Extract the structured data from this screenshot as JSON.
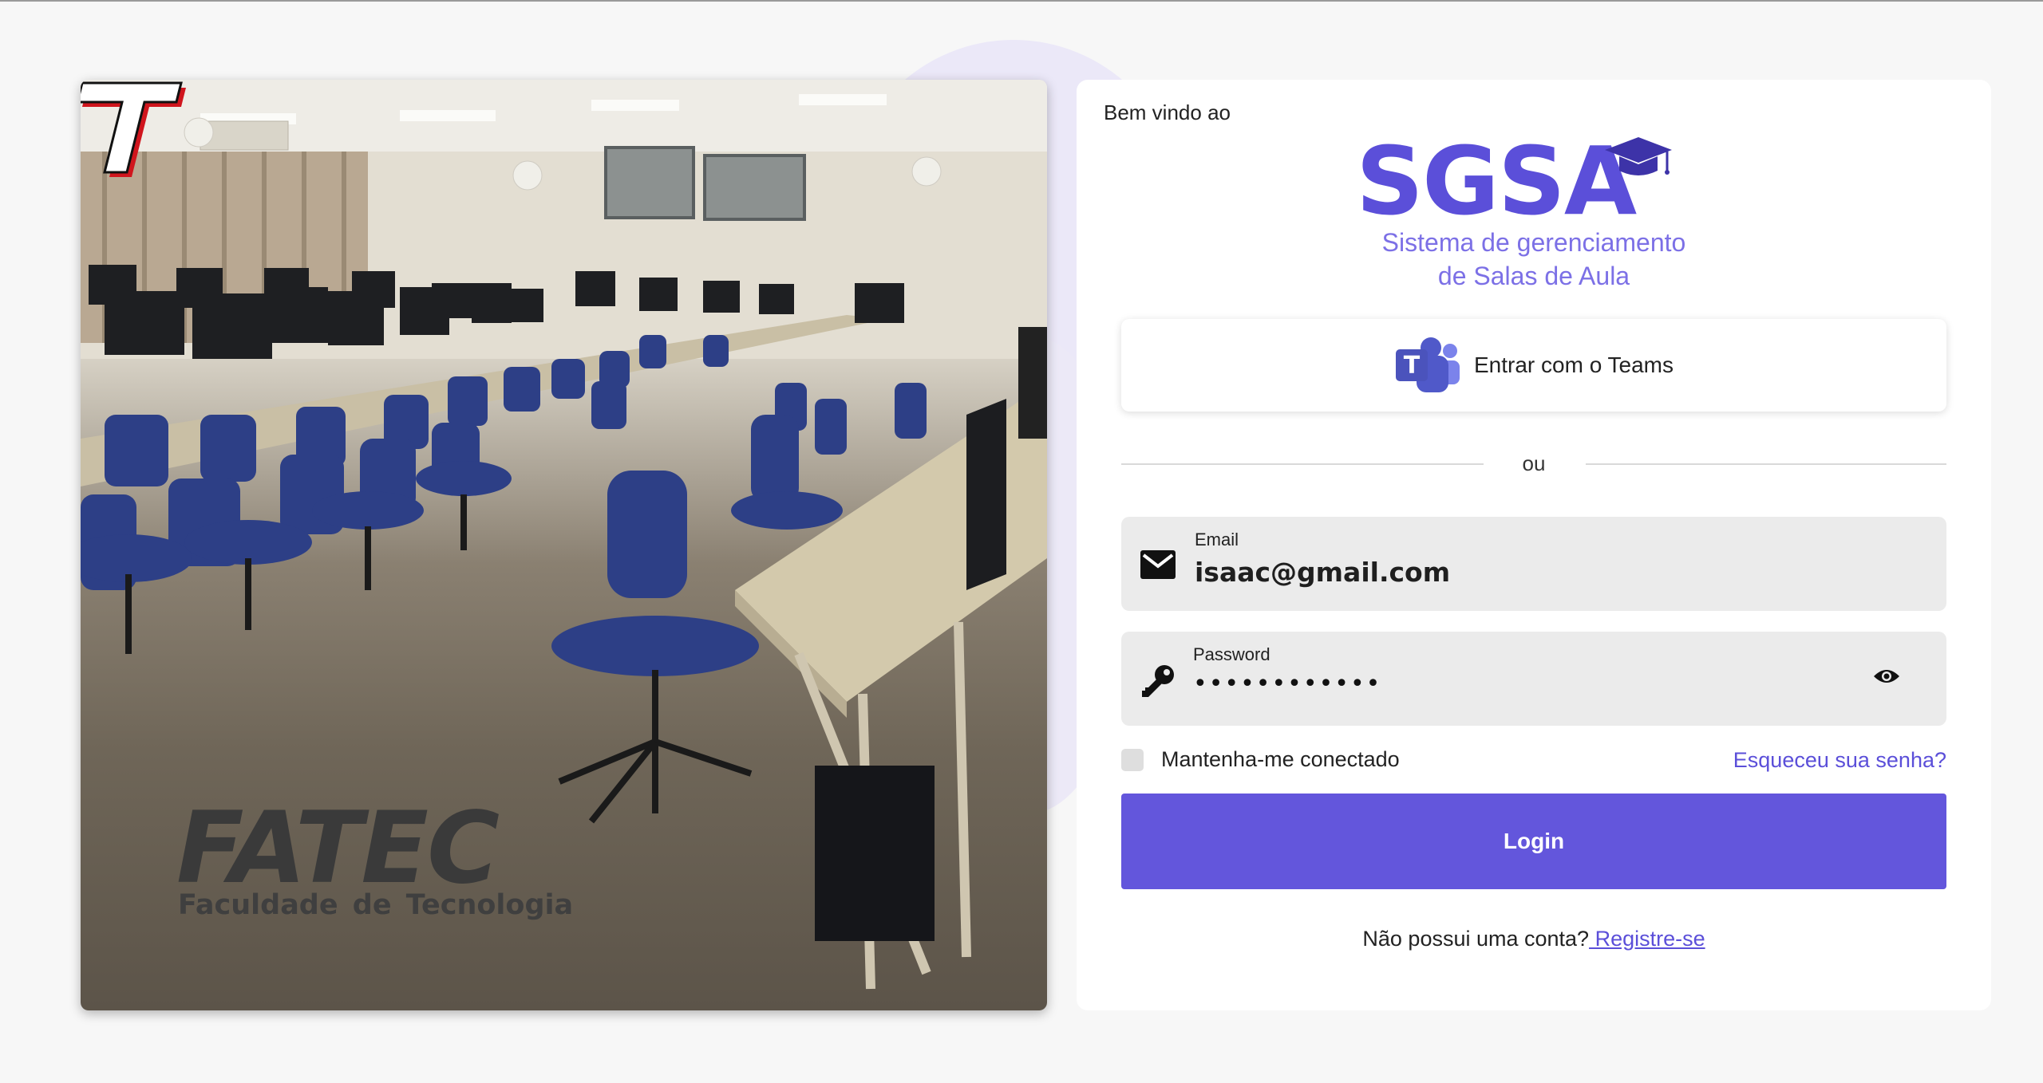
{
  "photo": {
    "logo_text": "FATEC",
    "logo_subtitle": "Faculdade de  Tecnologia"
  },
  "card": {
    "welcome": "Bem vindo ao",
    "brand": {
      "name": "SGSA",
      "tagline_line1": "Sistema de gerenciamento",
      "tagline_line2": "de Salas de Aula",
      "color": "#5b4fd9"
    },
    "teams_button": {
      "label": "Entrar com o Teams",
      "icon": "teams-icon"
    },
    "divider_text": "ou",
    "email": {
      "label": "Email",
      "value": "isaac@gmail.com",
      "icon": "mail-icon"
    },
    "password": {
      "label": "Password",
      "value": "••••••••••••",
      "icon": "key-icon",
      "toggle_icon": "eye-icon"
    },
    "remember_label": "Mantenha-me conectado",
    "remember_checked": false,
    "forgot_link": "Esqueceu sua senha?",
    "login_button": "Login",
    "login_color": "#6356dc",
    "register_prompt": "Não possui uma conta?",
    "register_link": " Registre-se"
  }
}
